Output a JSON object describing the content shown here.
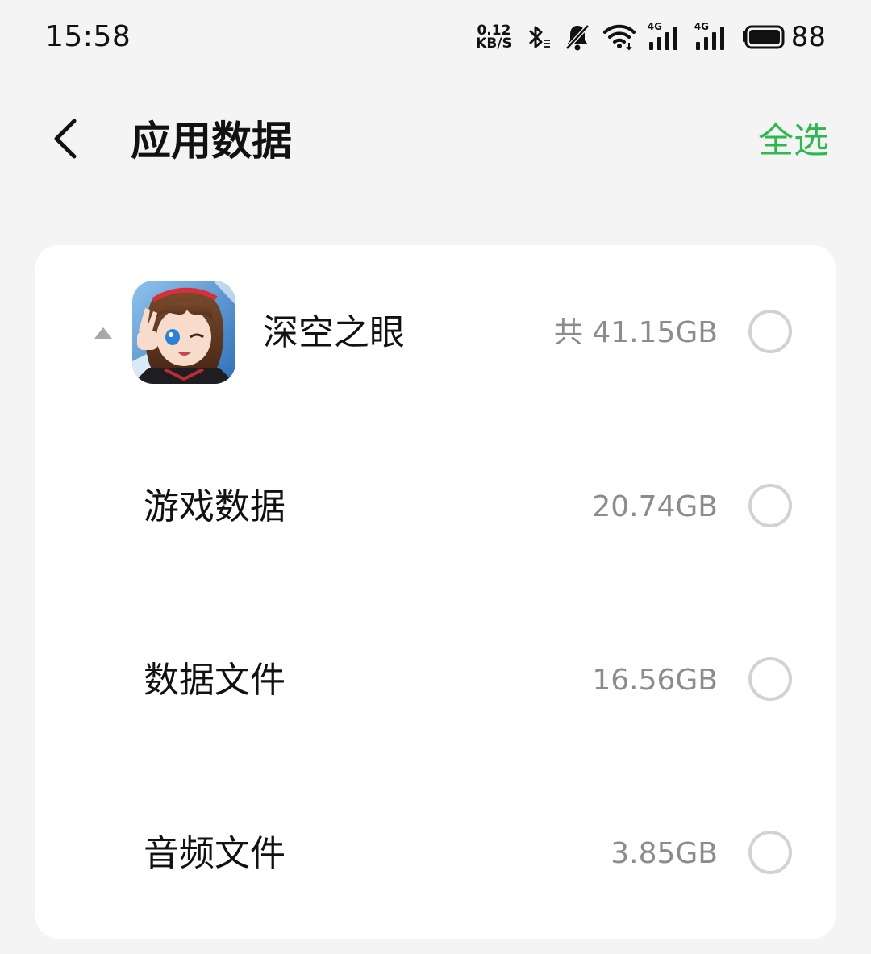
{
  "status_bar": {
    "time": "15:58",
    "net_speed_value": "0.12",
    "net_speed_unit": "KB/S",
    "battery_level": "88",
    "icons": [
      "bluetooth-icon",
      "mute-bell-icon",
      "wifi-icon",
      "4g-signal-icon",
      "4g-signal-icon",
      "battery-icon"
    ],
    "signal_label": "4G"
  },
  "header": {
    "title": "应用数据",
    "select_all_label": "全选",
    "back_icon": "back-chevron-icon",
    "accent_color": "#2fb84f"
  },
  "app": {
    "name": "深空之眼",
    "total_size": "共 41.15GB",
    "expanded": true,
    "selected": false
  },
  "items": [
    {
      "label": "游戏数据",
      "size": "20.74GB",
      "selected": false
    },
    {
      "label": "数据文件",
      "size": "16.56GB",
      "selected": false
    },
    {
      "label": "音频文件",
      "size": "3.85GB",
      "selected": false
    }
  ]
}
